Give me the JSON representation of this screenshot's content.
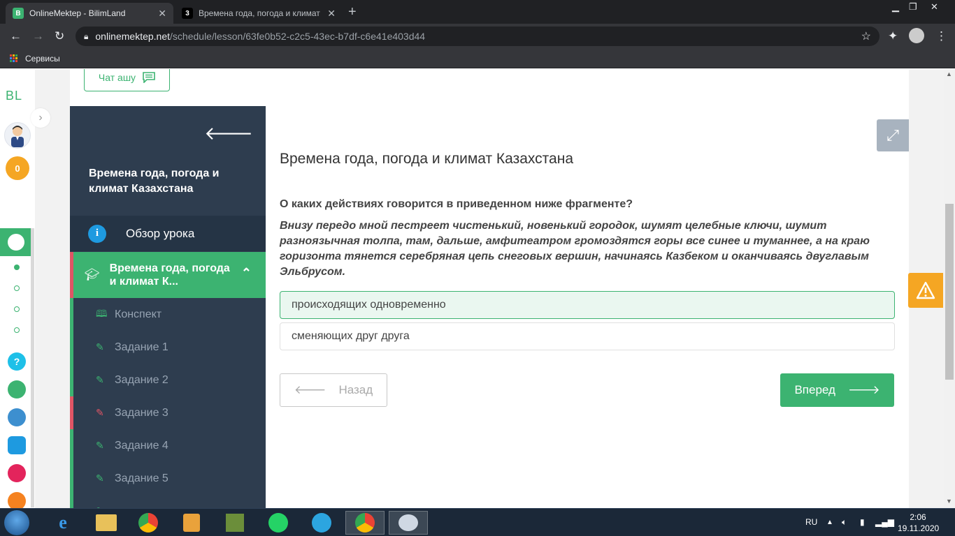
{
  "browser": {
    "tabs": [
      {
        "title": "OnlineMektep - BilimLand",
        "favicon": "bilimland-icon",
        "active": true
      },
      {
        "title": "Времена года, погода и климат",
        "favicon": "znanija-icon",
        "active": false
      }
    ],
    "url_host": "onlinemektep.net",
    "url_path": "/schedule/lesson/63fe0b52-c2c5-43ec-b7df-c6e41e403d44",
    "bookmarks_label": "Сервисы"
  },
  "rail": {
    "logo": "BL",
    "coins": "0",
    "chevron_label": "›"
  },
  "chat_button": "Чат ашу",
  "sidebar": {
    "title": "Времена года, погода и климат Казахстана",
    "overview_label": "Обзор урока",
    "active_label": "Времена года, погода и климат К...",
    "items": [
      {
        "label": "Конспект",
        "icon": "book-icon",
        "status": "done"
      },
      {
        "label": "Задание 1",
        "icon": "edit-icon",
        "status": "done"
      },
      {
        "label": "Задание 2",
        "icon": "edit-icon",
        "status": "done"
      },
      {
        "label": "Задание 3",
        "icon": "edit-icon",
        "status": "wrong"
      },
      {
        "label": "Задание 4",
        "icon": "edit-icon",
        "status": "done"
      },
      {
        "label": "Задание 5",
        "icon": "edit-icon",
        "status": "done"
      }
    ]
  },
  "main": {
    "lesson_title": "Времена года, погода и климат Казахстана",
    "question": "О каких действиях говорится в приведенном ниже фрагменте?",
    "fragment": "Внизу передо мной пестреет чистенький, новенький городок, шумят целебные ключи, шумит разноязычная толпа, там, дальше, амфитеатром громоздятся горы все синее и туманнее, а на краю горизонта тянется серебряная цепь снеговых вершин, начинаясь Казбеком и оканчиваясь двуглавым Эльбрусом.",
    "answers": [
      {
        "label": "происходящих одновременно",
        "selected": true
      },
      {
        "label": "сменяющих друг друга",
        "selected": false
      }
    ],
    "back_label": "Назад",
    "next_label": "Вперед"
  },
  "taskbar": {
    "lang": "RU",
    "time": "2:06",
    "date": "19.11.2020"
  },
  "colors": {
    "accent_green": "#3cb371",
    "sidebar_bg": "#2e3d4f",
    "error_red": "#e05565",
    "warning_orange": "#f5a623"
  }
}
